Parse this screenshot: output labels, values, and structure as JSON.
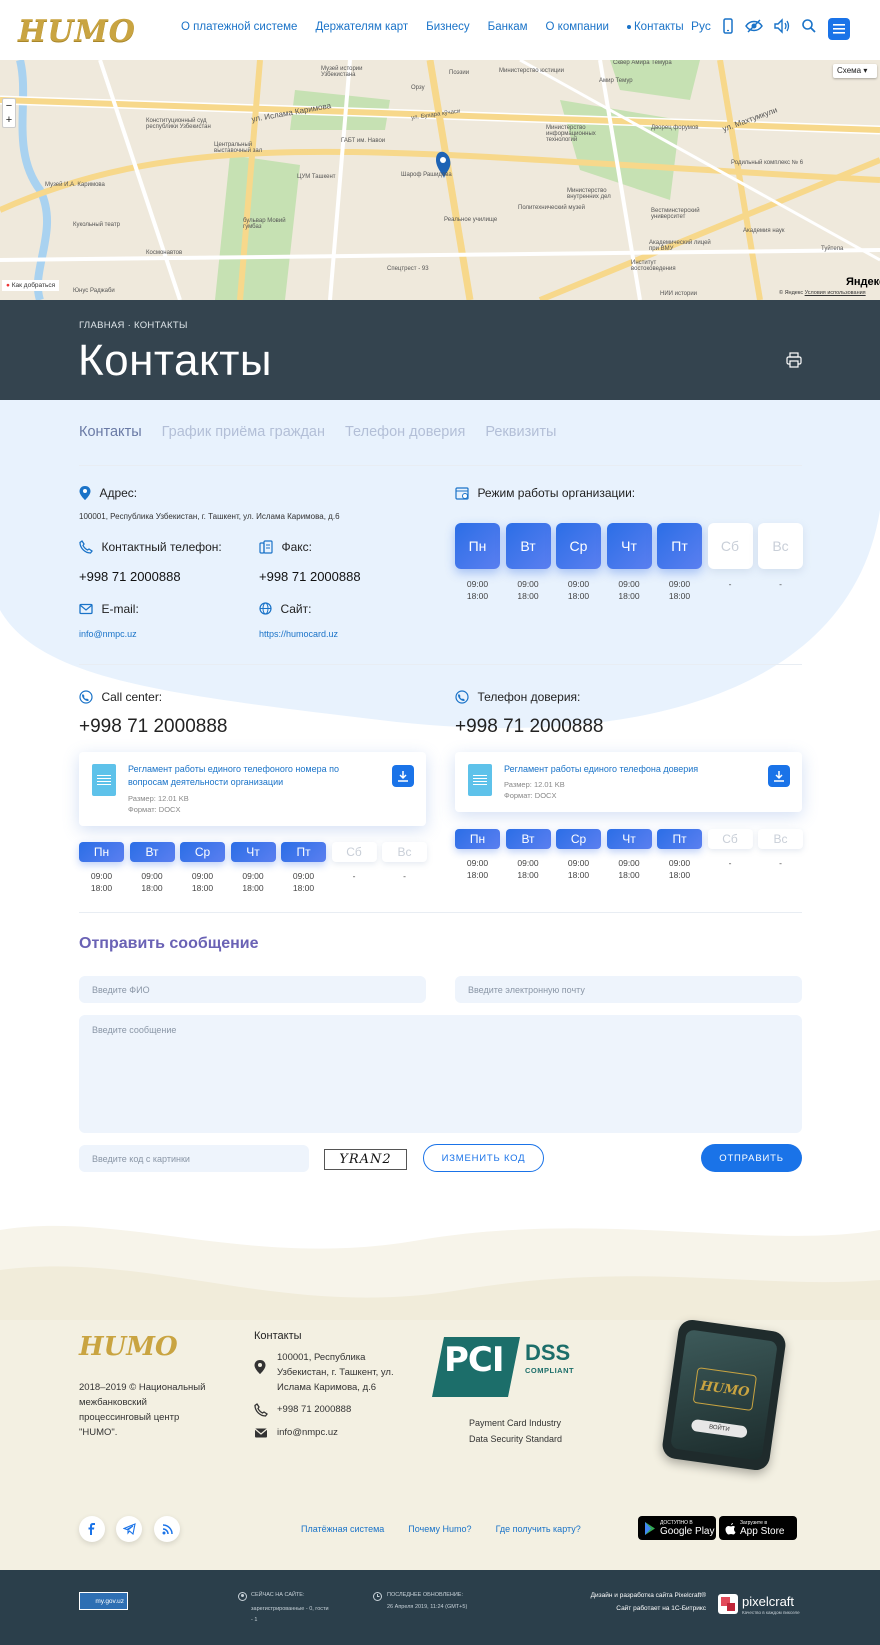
{
  "header": {
    "logo": "HUMO",
    "nav": [
      "О платежной системе",
      "Держателям карт",
      "Бизнесу",
      "Банкам",
      "О компании",
      "Контакты"
    ],
    "lang": "Рус"
  },
  "map": {
    "scheme_btn": "Схема",
    "zoom_in": "+",
    "zoom_out": "−",
    "route_link": "Как добраться",
    "yandex": "Яндекс",
    "copyright": "© Яндекс",
    "terms": "Условия использования",
    "labels": [
      "Музей истории Узбекистана",
      "Орзу",
      "Поэзии",
      "Министерство юстиции",
      "Сквер Амира Темура",
      "Амир Темур",
      "ул. Ислама Каримова",
      "ул. Бухара кўчаси",
      "Конституционный суд республики Узбекистан",
      "Центральный выставочный зал",
      "ГАБТ им. Навои",
      "Министерство информационных технологий",
      "Дворец форумов",
      "ул. Махтумкули",
      "Родильный комплекс № 6",
      "Музей И.А. Каримова",
      "ЦУМ Ташкент",
      "Шароф Рашидова",
      "Министерство внутренних дел",
      "Кукольный театр",
      "бульвар Мовий гумбаз",
      "Политехнический музей",
      "Вестминстерский университет",
      "Академия наук",
      "Космонавтов",
      "Реальное училище",
      "Академический лицей при ВМУ",
      "Туйтепа",
      "Юнус Раджаби",
      "Спецтрест - 93",
      "Институт востоковедения",
      "НИИ истории"
    ]
  },
  "hero": {
    "breadcrumb": "ГЛАВНАЯ · КОНТАКТЫ",
    "title": "Контакты"
  },
  "tabs": [
    "Контакты",
    "График приёма граждан",
    "Телефон доверия",
    "Реквизиты"
  ],
  "address": {
    "label": "Адрес:",
    "value": "100001, Республика Узбекистан, г. Ташкент, ул. Ислама Каримова, д.6"
  },
  "phone": {
    "label": "Контактный телефон:",
    "value": "+998 71 2000888"
  },
  "fax": {
    "label": "Факс:",
    "value": "+998 71 2000888"
  },
  "email": {
    "label": "E-mail:",
    "value": "info@nmpc.uz"
  },
  "site": {
    "label": "Сайт:",
    "value": "https://humocard.uz"
  },
  "worktime": {
    "label": "Режим работы организации:"
  },
  "days": [
    "Пн",
    "Вт",
    "Ср",
    "Чт",
    "Пт",
    "Сб",
    "Вс"
  ],
  "hours": [
    [
      "09:00",
      "18:00"
    ],
    [
      "09:00",
      "18:00"
    ],
    [
      "09:00",
      "18:00"
    ],
    [
      "09:00",
      "18:00"
    ],
    [
      "09:00",
      "18:00"
    ],
    [
      "-",
      ""
    ],
    [
      "-",
      ""
    ]
  ],
  "callcenter": {
    "label": "Call center:",
    "phone": "+998 71 2000888",
    "doc_title": "Регламент работы единого телефоного номера по вопросам деятельности организации",
    "doc_size": "Размер: 12.01 KB",
    "doc_format": "Формат: DOCX"
  },
  "trust": {
    "label": "Телефон доверия:",
    "phone": "+998 71 2000888",
    "doc_title": "Регламент работы единого телефона доверия",
    "doc_size": "Размер: 12.01 KB",
    "doc_format": "Формат: DOCX"
  },
  "form": {
    "title": "Отправить сообщение",
    "name_ph": "Введите ФИО",
    "email_ph": "Введите электронную почту",
    "msg_ph": "Введите сообщение",
    "captcha_ph": "Введите код с картинки",
    "captcha_text": "YRAN2",
    "change_btn": "ИЗМЕНИТЬ КОД",
    "send_btn": "ОТПРАВИТЬ"
  },
  "footer": {
    "logo": "HUMO",
    "copyright": "2018–2019 © Национальный межбанковский процессинговый центр \"HUMO\".",
    "contacts_title": "Контакты",
    "address": "100001, Республика Узбекистан, г. Ташкент, ул. Ислама Каримова, д.6",
    "phone": "+998 71 2000888",
    "email": "info@nmpc.uz",
    "pci_text1": "Payment Card Industry",
    "pci_text2": "Data Security Standard",
    "pci_logo": "PCI",
    "dss": "DSS",
    "compliant": "COMPLIANT",
    "links": [
      "Платёжная система",
      "Почему Humo?",
      "Где получить карту?"
    ],
    "phone_logo": "HUMO",
    "phone_btn": "ВОЙТИ",
    "gplay_small": "ДОСТУПНО В",
    "gplay": "Google Play",
    "appstore_small": "Загрузите в",
    "appstore": "App Store"
  },
  "bottom": {
    "mygov": "my.gov.uz",
    "online_title": "СЕЙЧАС НА САЙТЕ:",
    "online_value": "зарегистрированные - 0, гости - 1",
    "update_title": "ПОСЛЕДНЕЕ ОБНОВЛЕНИЕ:",
    "update_value": "26 Апреля 2019, 11:24 (GMT+5)",
    "design": "Дизайн и разработка сайта Pixelcraft®",
    "bitrix": "Сайт работает на 1С-Битрикс",
    "pixelcraft": "pixelcraft",
    "pixel_sub": "Качество в каждом пикселе"
  },
  "colors": {
    "accent": "#1a73e8",
    "dark": "#34444f",
    "gold": "#c9a441",
    "footer_bg": "#f3f0e2"
  }
}
